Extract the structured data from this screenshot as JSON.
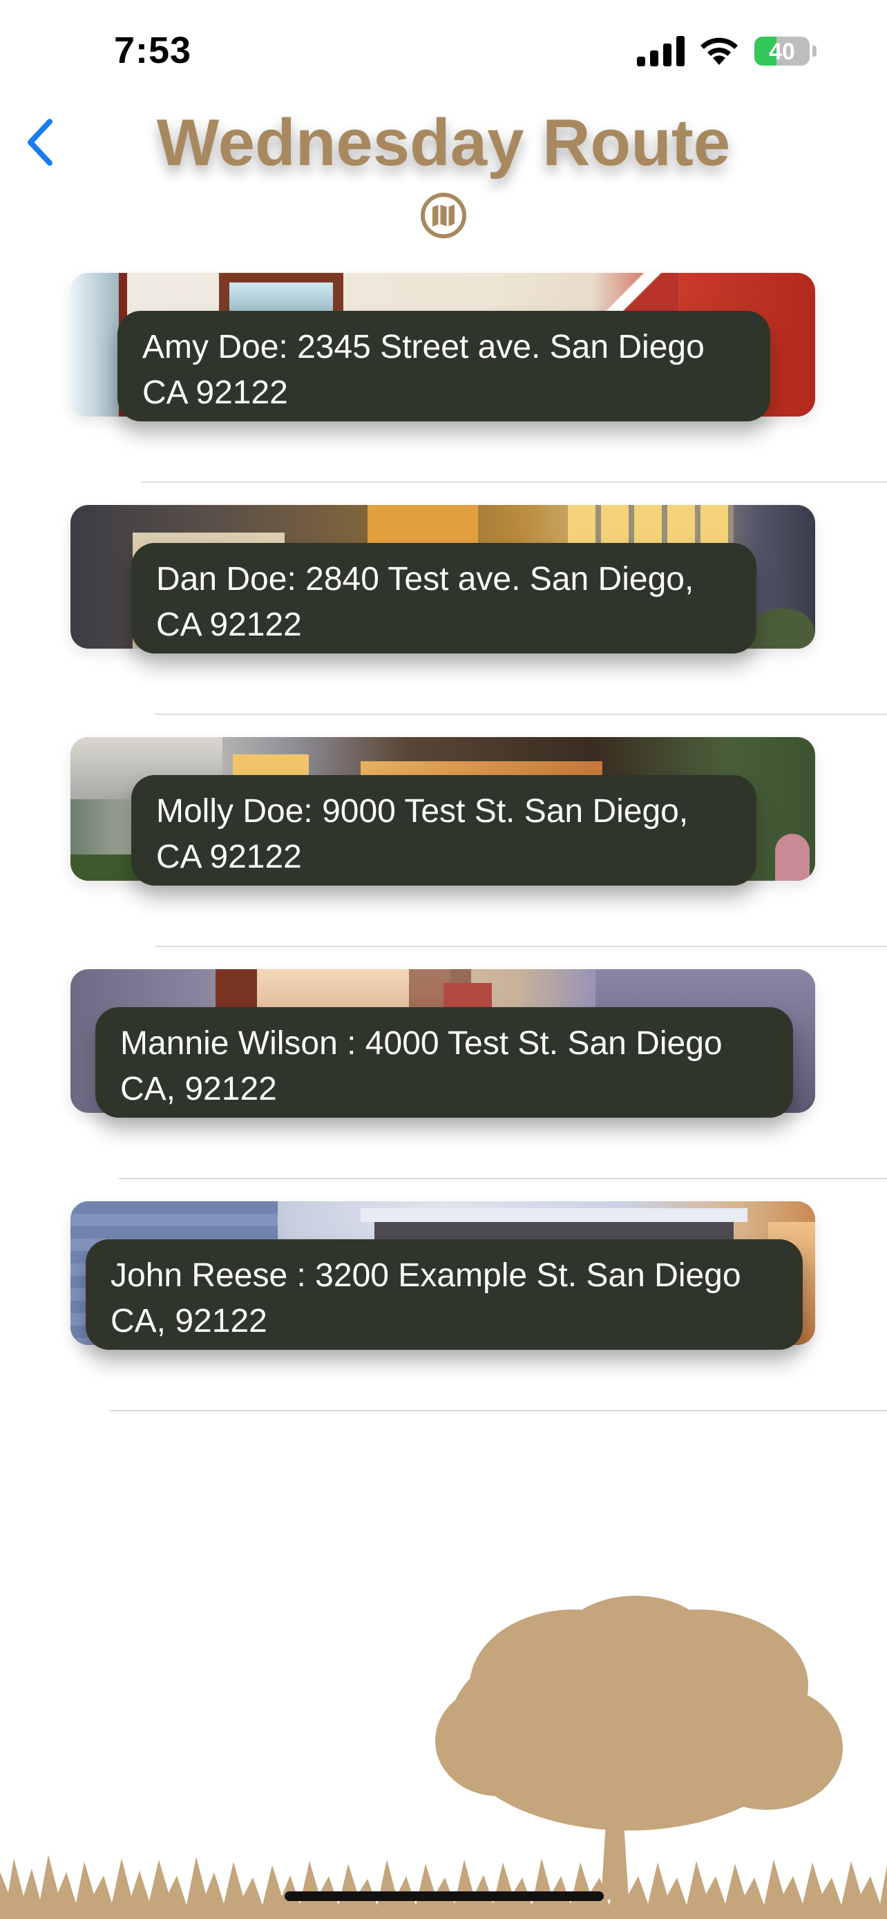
{
  "status_bar": {
    "time": "7:53",
    "battery_percent": "40",
    "icons": [
      "signal-icon",
      "wifi-icon",
      "battery-charging-icon"
    ]
  },
  "header": {
    "title": "Wednesday Route",
    "back_icon": "chevron-left-icon",
    "map_icon": "map-icon"
  },
  "colors": {
    "title": "#a8895f",
    "label_bg": "#2f352a",
    "back_accent": "#1a7cf0",
    "tree": "#c4a57c"
  },
  "stops": [
    {
      "label": "Amy Doe: 2345 Street ave. San Diego CA 92122"
    },
    {
      "label": "Dan Doe: 2840 Test ave. San Diego, CA 92122"
    },
    {
      "label": "Molly Doe: 9000 Test St. San Diego, CA 92122"
    },
    {
      "label": "Mannie Wilson : 4000 Test St. San Diego CA, 92122"
    },
    {
      "label": "John Reese : 3200 Example St. San Diego CA, 92122"
    }
  ]
}
